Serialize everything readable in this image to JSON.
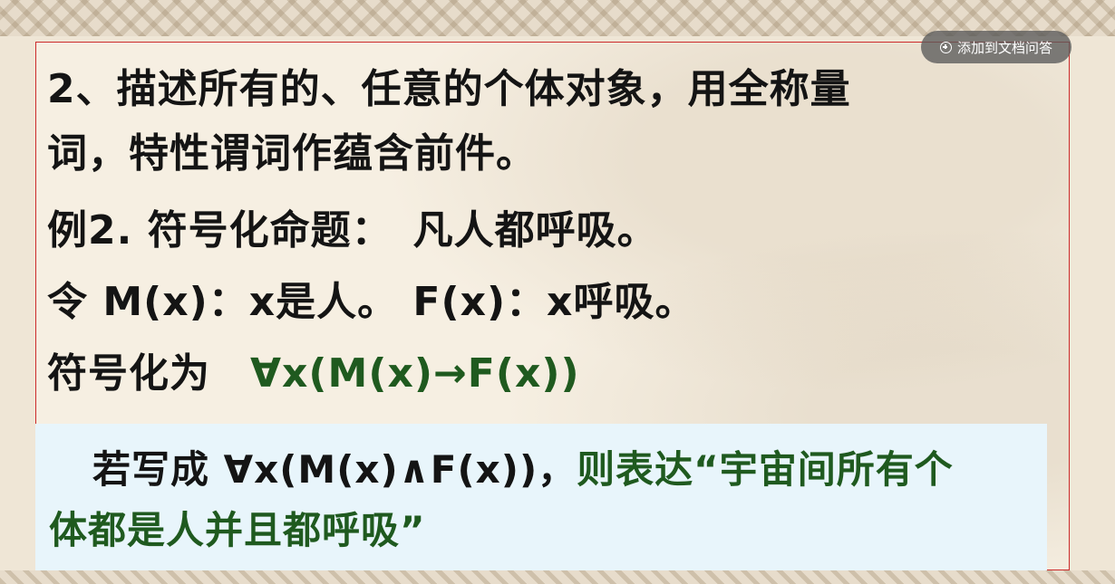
{
  "overlay": {
    "add_button_label": "添加到文档问答"
  },
  "slide": {
    "line1": "2、描述所有的、任意的个体对象，用全称量",
    "line2": "词，特性谓词作蕴含前件。",
    "line3": "例2. 符号化命题：　凡人都呼吸。",
    "line4": "令  M(x)：x是人。  F(x)：x呼吸。",
    "line5_prefix": "符号化为",
    "line5_formula": "∀x(M(x)→F(x))",
    "note_line1_black": "若写成 ∀x(M(x)∧F(x))，",
    "note_line1_green": "则表达“宇宙间所有个",
    "note_line2_green": "体都是人并且都呼吸”"
  },
  "colors": {
    "text": "#141414",
    "highlight_green": "#1f5a1f",
    "frame_border": "#cc2b2b",
    "note_background": "#e8f5fb"
  }
}
